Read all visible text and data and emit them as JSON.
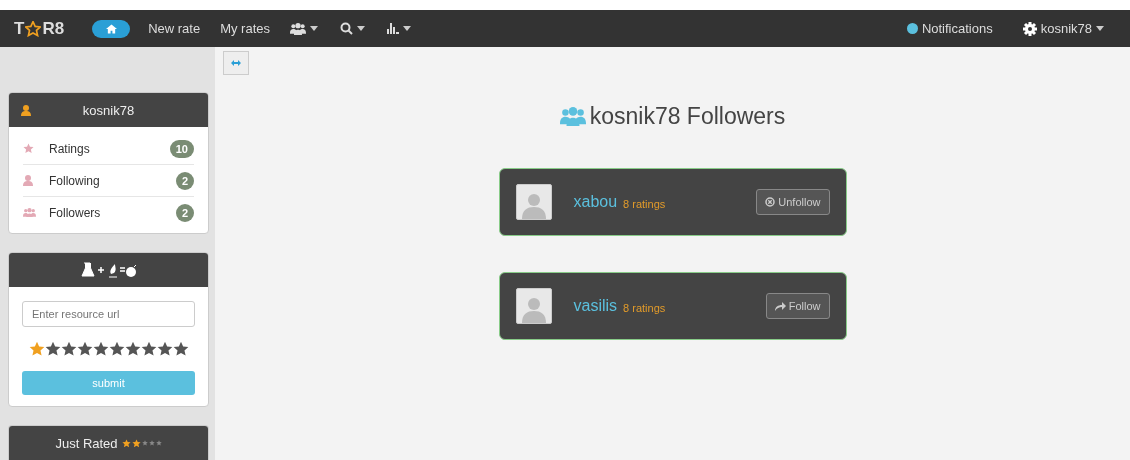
{
  "navbar": {
    "logo_left": "T",
    "logo_right": "R8",
    "items": [
      {
        "kind": "home",
        "selected": true
      },
      {
        "kind": "text",
        "label": "New rate",
        "selected": false
      },
      {
        "kind": "text",
        "label": "My rates",
        "selected": false
      },
      {
        "kind": "users-menu",
        "selected": false
      },
      {
        "kind": "search-menu",
        "selected": false
      },
      {
        "kind": "chart-menu",
        "selected": false
      }
    ],
    "notifications": "Notifications",
    "user": "kosnik78"
  },
  "profile": {
    "name": "kosnik78",
    "items": [
      {
        "kind": "star",
        "label": "Ratings",
        "count": "10"
      },
      {
        "kind": "user",
        "label": "Following",
        "count": "2"
      },
      {
        "kind": "users",
        "label": "Followers",
        "count": "2"
      }
    ]
  },
  "rate_panel": {
    "placeholder": "Enter resource url",
    "stars": 1,
    "submit": "submit"
  },
  "just_rated": {
    "title": "Just Rated",
    "stars": 2
  },
  "page": {
    "title": "kosnik78 Followers",
    "followers": [
      {
        "name": "xabou",
        "ratings": "8 ratings",
        "following": true,
        "action": "Unfollow"
      },
      {
        "name": "vasilis",
        "ratings": "8 ratings",
        "following": false,
        "action": "Follow"
      }
    ]
  }
}
